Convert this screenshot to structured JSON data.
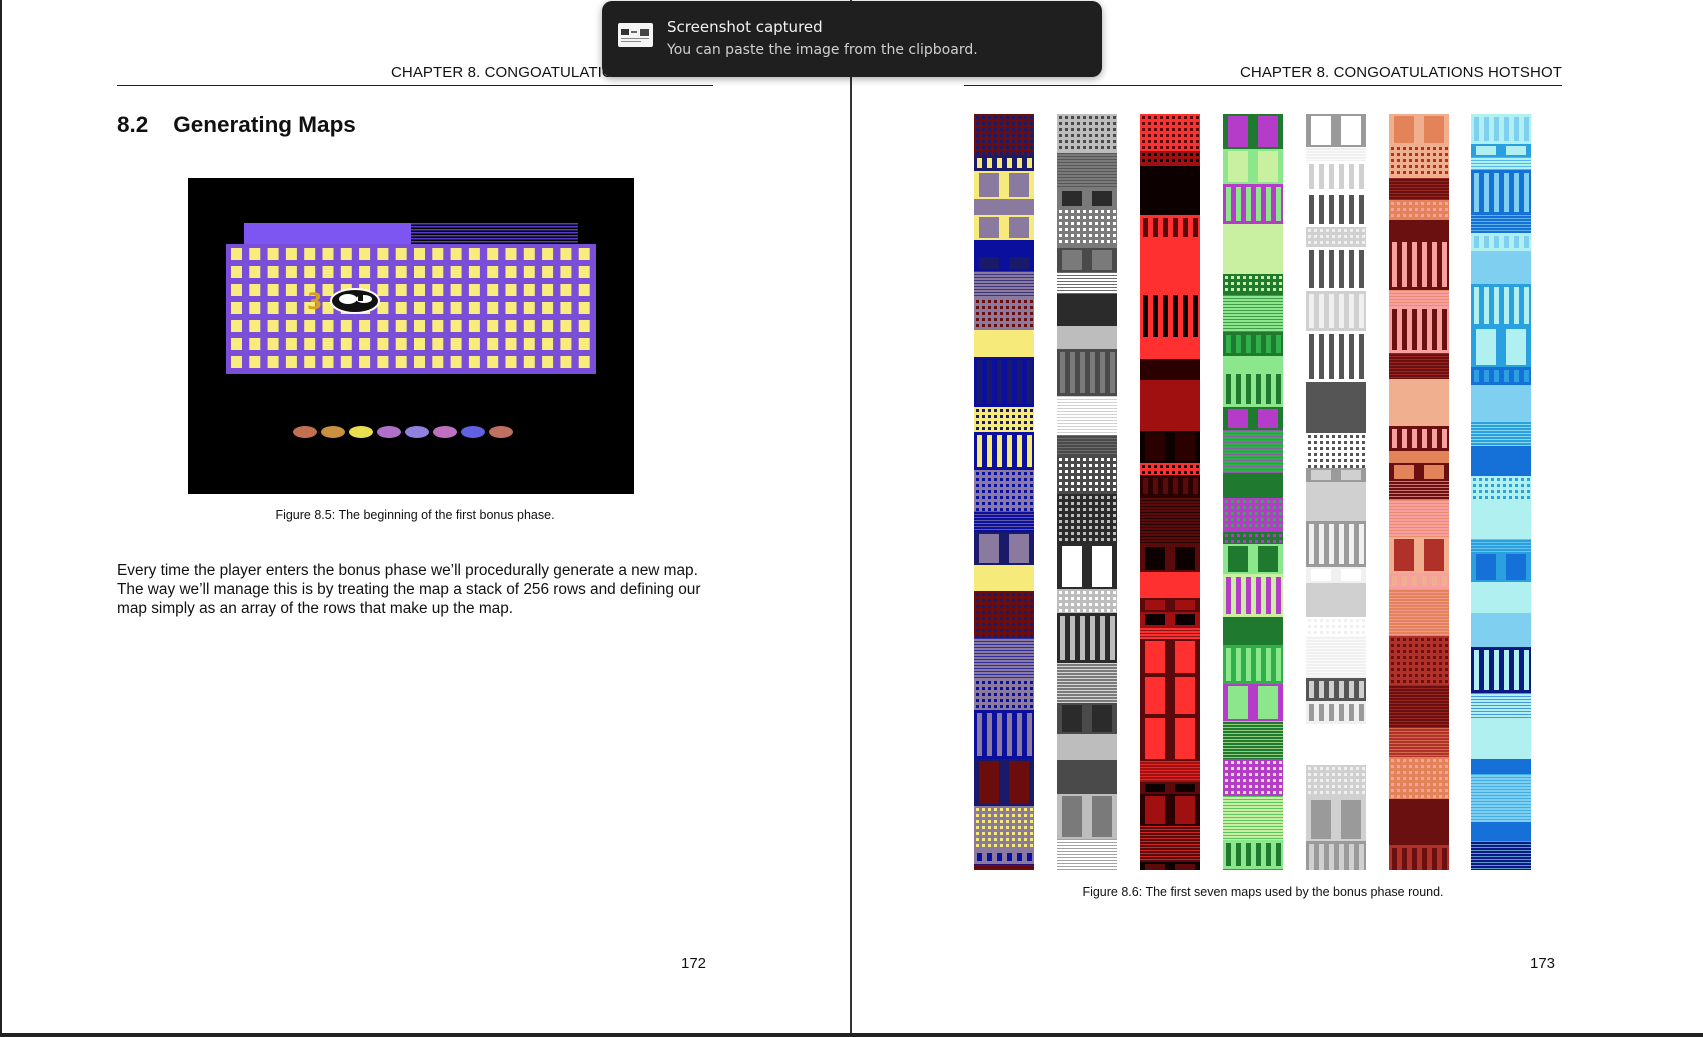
{
  "notification": {
    "title": "Screenshot captured",
    "body": "You can paste the image from the clipboard.",
    "icon": "screenshot-thumbnail-icon"
  },
  "left_page": {
    "running_head": "CHAPTER 8.  CONGOATULATIONS HOTSHOT",
    "section_title": "8.2    Generating Maps",
    "figure_caption": "Figure 8.5: The beginning of the first bonus phase.",
    "paragraph": "Every time the player enters the bonus phase we’ll procedurally generate a new map. The way we’ll manage this is by treating the map a stack of 256 rows and defining our map simply as an array of the rows that make up the map.",
    "page_number": "172",
    "game_score": "3"
  },
  "right_page": {
    "running_head": "CHAPTER 8.  CONGOATULATIONS HOTSHOT",
    "figure_caption": "Figure 8.6: The first seven maps used by the bonus phase round.",
    "page_number": "173"
  },
  "map_strips": [
    {
      "name": "map-1",
      "palette": [
        "#0b0f9e",
        "#f5ea7a",
        "#6b0d0d",
        "#8b7aa0",
        "#1a1a6a"
      ]
    },
    {
      "name": "map-2",
      "palette": [
        "#4a4a4a",
        "#bdbdbd",
        "#ffffff",
        "#7a7a7a",
        "#2b2b2b"
      ]
    },
    {
      "name": "map-3",
      "palette": [
        "#0d0000",
        "#5a0a0a",
        "#a01010",
        "#2a0000",
        "#ff3030"
      ]
    },
    {
      "name": "map-4",
      "palette": [
        "#2fb04a",
        "#8ce68c",
        "#b43cc8",
        "#1f7a2f",
        "#c8f0a0"
      ]
    },
    {
      "name": "map-5",
      "palette": [
        "#f0f0f0",
        "#9a9a9a",
        "#d0d0d0",
        "#555555",
        "#ffffff"
      ]
    },
    {
      "name": "map-6",
      "palette": [
        "#e2835a",
        "#6b1010",
        "#f8a0a0",
        "#b0302a",
        "#f0b090"
      ]
    },
    {
      "name": "map-7",
      "palette": [
        "#1570d8",
        "#7fd0f0",
        "#0a1a80",
        "#b0f0f0",
        "#2aa0e0"
      ]
    }
  ],
  "colors": {
    "game_border": "#7b4ed8",
    "game_window": "#f7ec7c",
    "game_header": "#8a5cff"
  }
}
